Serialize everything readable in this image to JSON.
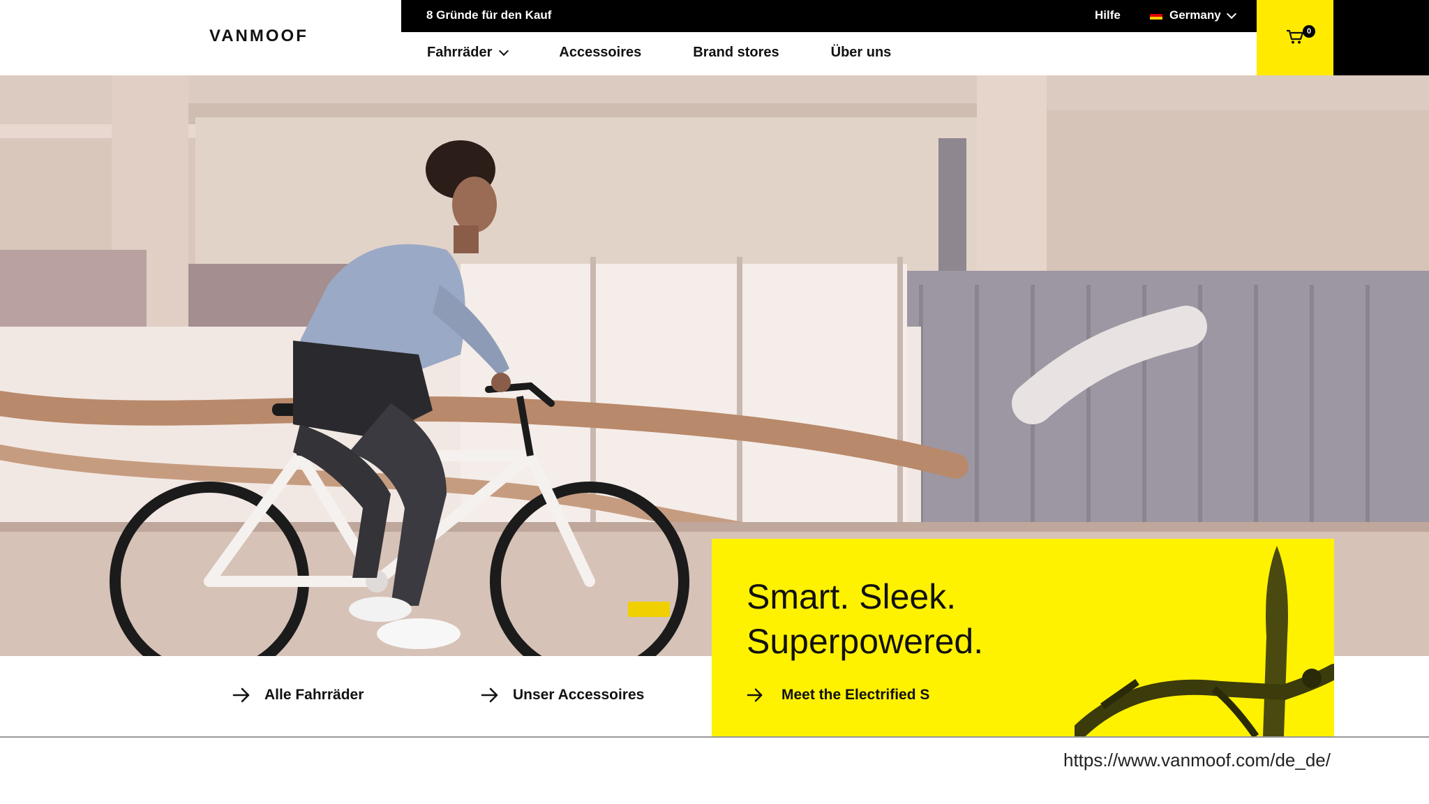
{
  "brand": {
    "logo_text": "VANMOOF"
  },
  "topbar": {
    "promo": "8 Gründe für den Kauf",
    "help": "Hilfe",
    "country": "Germany"
  },
  "nav": {
    "items": [
      {
        "label": "Fahrräder",
        "has_dropdown": true
      },
      {
        "label": "Accessoires"
      },
      {
        "label": "Brand stores"
      },
      {
        "label": "Über uns"
      }
    ]
  },
  "cart": {
    "count": "0"
  },
  "links": {
    "all_bikes": "Alle Fahrräder",
    "accessories": "Unser Accessoires"
  },
  "promo_card": {
    "line1": "Smart. Sleek.",
    "line2": "Superpowered.",
    "cta": "Meet the Electrified S"
  },
  "footer": {
    "url": "https://www.vanmoof.com/de_de/"
  },
  "colors": {
    "accent_yellow": "#fff200",
    "black": "#000000",
    "white": "#ffffff"
  }
}
